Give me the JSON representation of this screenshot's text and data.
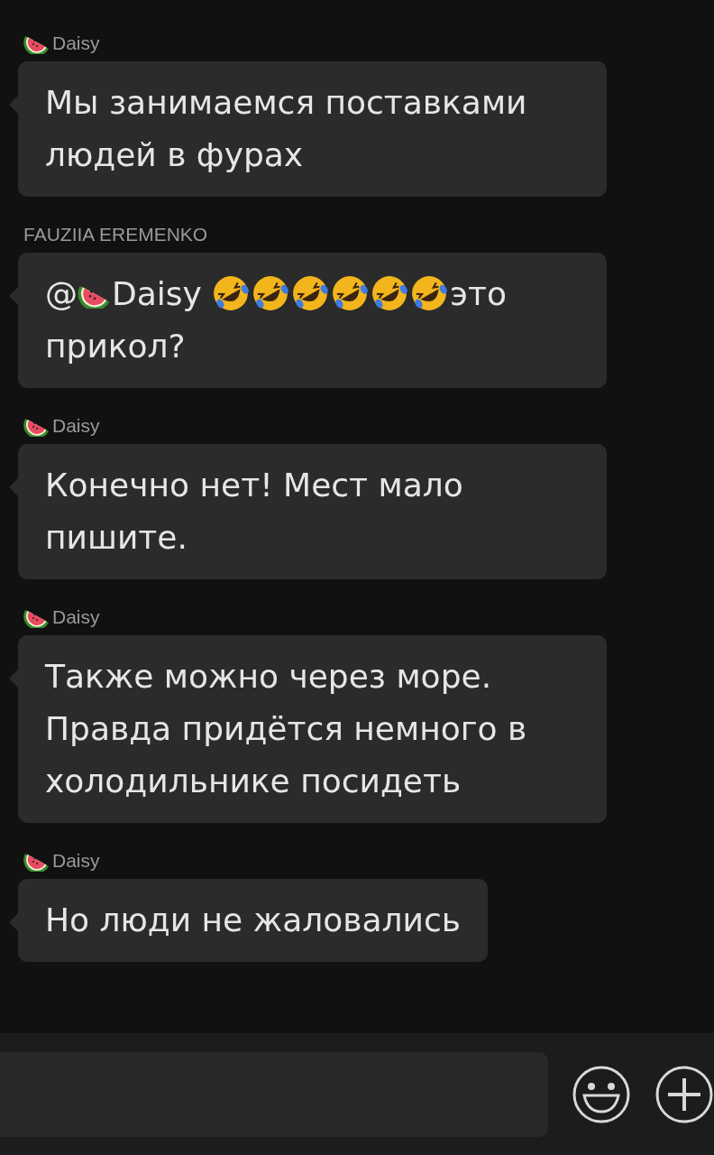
{
  "messages": [
    {
      "sender": {
        "name": "Daisy",
        "kind": "with_icon"
      },
      "parts": [
        {
          "kind": "text",
          "text": "Мы занимаемся поставками людей в фурах"
        }
      ]
    },
    {
      "sender": {
        "name": "FAUZIIA EREMENKO",
        "kind": "plain"
      },
      "parts": [
        {
          "kind": "text",
          "text": "@"
        },
        {
          "kind": "watermelon"
        },
        {
          "kind": "text",
          "text": "Daisy "
        },
        {
          "kind": "laugh"
        },
        {
          "kind": "laugh"
        },
        {
          "kind": "laugh"
        },
        {
          "kind": "laugh"
        },
        {
          "kind": "laugh"
        },
        {
          "kind": "laugh"
        },
        {
          "kind": "text",
          "text": "это "
        },
        {
          "kind": "text",
          "text": "прикол?"
        }
      ]
    },
    {
      "sender": {
        "name": "Daisy",
        "kind": "with_icon"
      },
      "parts": [
        {
          "kind": "text",
          "text": "Конечно нет! Мест мало пишите."
        }
      ]
    },
    {
      "sender": {
        "name": "Daisy",
        "kind": "with_icon"
      },
      "parts": [
        {
          "kind": "text",
          "text": "Также можно через море. Правда придётся немного в холодильнике посидеть"
        }
      ]
    },
    {
      "sender": {
        "name": "Daisy",
        "kind": "with_icon"
      },
      "parts": [
        {
          "kind": "text",
          "text": "Но люди не жаловались"
        }
      ]
    }
  ]
}
